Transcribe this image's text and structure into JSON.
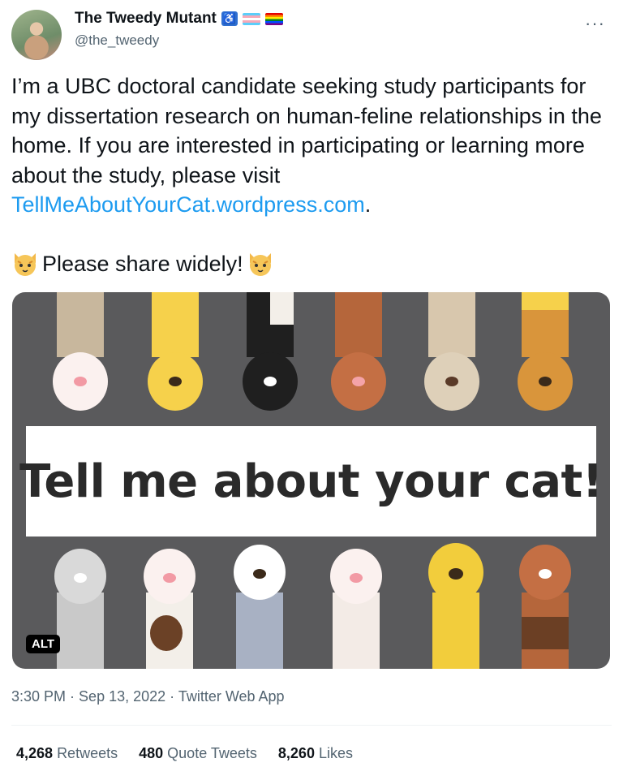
{
  "author": {
    "display_name": "The Tweedy Mutant",
    "handle": "@the_tweedy",
    "badges": [
      "wheelchair-icon",
      "trans-flag-icon",
      "pride-flag-icon"
    ]
  },
  "more_label": "···",
  "tweet": {
    "text_before_link": "I’m a UBC doctoral candidate seeking study participants for my dissertation research on human-feline relationships in the home. If you are interested in participating or learning more about the study, please visit ",
    "link": "TellMeAboutYourCat.wordpress.com",
    "text_after_link": ".",
    "share_line": "Please share widely!"
  },
  "media": {
    "banner_text": "Tell me about your cat!",
    "alt_label": "ALT",
    "colors": {
      "background": "#5a5a5c",
      "banner": "#ffffff"
    }
  },
  "meta": {
    "time": "3:30 PM",
    "separator": " · ",
    "date": "Sep 13, 2022",
    "source": "Twitter Web App"
  },
  "stats": {
    "retweets_count": "4,268",
    "retweets_label": "Retweets",
    "quotes_count": "480",
    "quotes_label": "Quote Tweets",
    "likes_count": "8,260",
    "likes_label": "Likes"
  },
  "colors": {
    "link": "#1d9bf0",
    "secondary_text": "#536471",
    "primary_text": "#0f1419"
  }
}
